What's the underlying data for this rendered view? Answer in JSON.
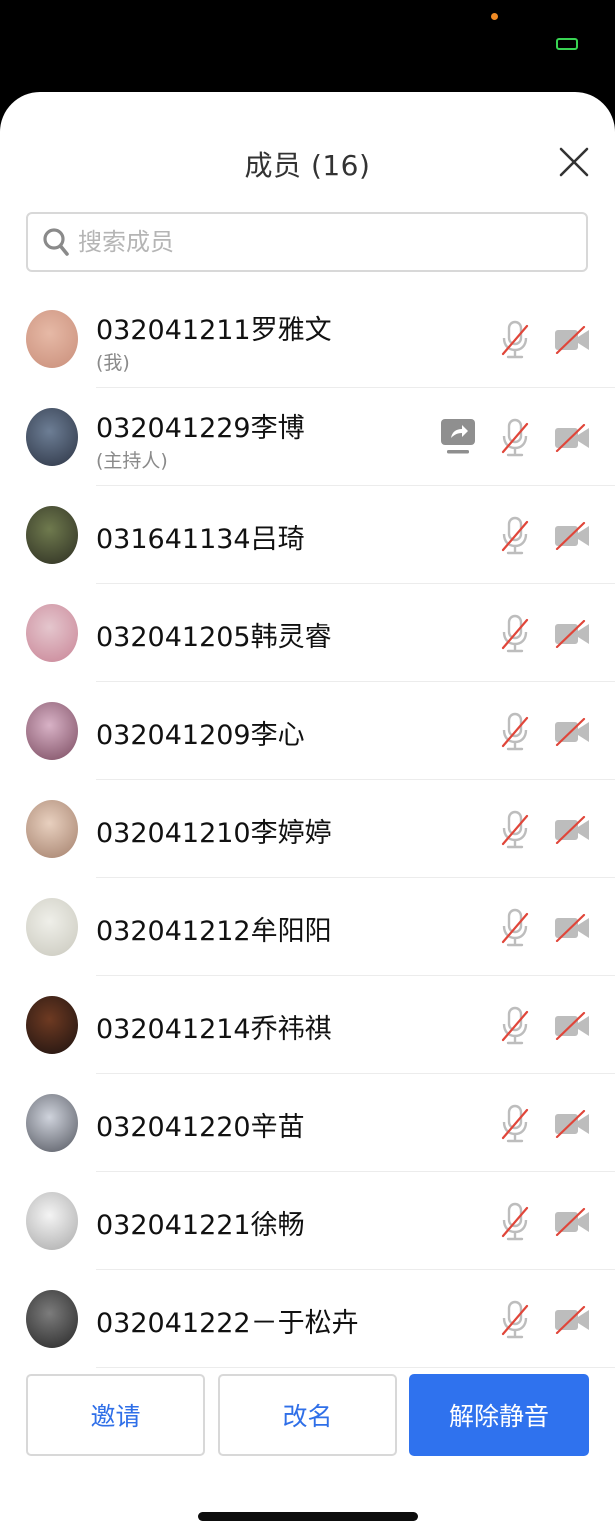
{
  "header": {
    "title": "成员 (16)"
  },
  "search": {
    "placeholder": "搜索成员"
  },
  "members": [
    {
      "name": "032041211罗雅文",
      "role": "(我)",
      "avatar_colors": [
        "#e6b9a6",
        "#c98e7a"
      ],
      "sharing": false
    },
    {
      "name": "032041229李博",
      "role": "(主持人)",
      "avatar_colors": [
        "#6d7e95",
        "#2c3444"
      ],
      "sharing": true
    },
    {
      "name": "031641134吕琦",
      "role": "",
      "avatar_colors": [
        "#6f7a4e",
        "#2d2e22"
      ],
      "sharing": false
    },
    {
      "name": "032041205韩灵睿",
      "role": "",
      "avatar_colors": [
        "#e4c6cd",
        "#c98496"
      ],
      "sharing": false
    },
    {
      "name": "032041209李心",
      "role": "",
      "avatar_colors": [
        "#d8b2c6",
        "#7a4a5f"
      ],
      "sharing": false
    },
    {
      "name": "032041210李婷婷",
      "role": "",
      "avatar_colors": [
        "#e8d0bf",
        "#a37f6b"
      ],
      "sharing": false
    },
    {
      "name": "032041212牟阳阳",
      "role": "",
      "avatar_colors": [
        "#efefe9",
        "#c9c8bd"
      ],
      "sharing": false
    },
    {
      "name": "032041214乔祎祺",
      "role": "",
      "avatar_colors": [
        "#6e3a22",
        "#1c1210"
      ],
      "sharing": false
    },
    {
      "name": "032041220辛苗",
      "role": "",
      "avatar_colors": [
        "#cfd3dc",
        "#53565f"
      ],
      "sharing": false
    },
    {
      "name": "032041221徐畅",
      "role": "",
      "avatar_colors": [
        "#f4f4f4",
        "#a9a9a9"
      ],
      "sharing": false
    },
    {
      "name": "032041222－于松卉",
      "role": "",
      "avatar_colors": [
        "#7c7c7c",
        "#262626"
      ],
      "sharing": false
    }
  ],
  "actions": {
    "invite": "邀请",
    "rename": "改名",
    "unmute": "解除静音"
  },
  "colors": {
    "accent": "#2f72ee",
    "muted_slash": "#e0463a",
    "icon_gray": "#bdbdbd"
  }
}
